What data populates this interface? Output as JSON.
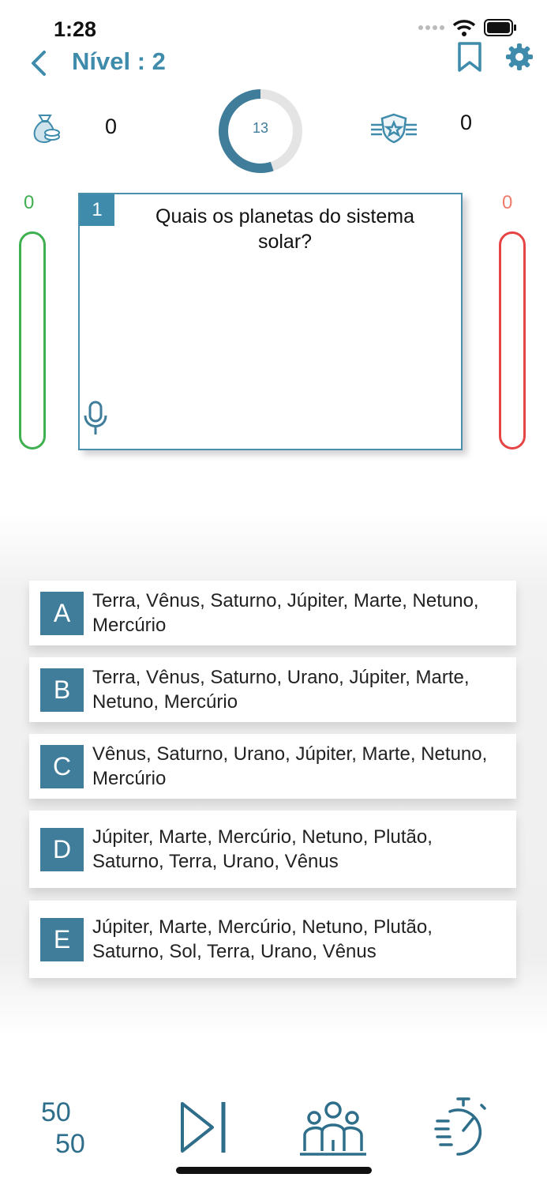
{
  "status_bar": {
    "time": "1:28"
  },
  "nav": {
    "title": "Nível : 2",
    "back_icon": "chevron-left-icon",
    "bookmark_icon": "bookmark-icon",
    "settings_icon": "gear-icon"
  },
  "stats": {
    "coins": "0",
    "timer": "13",
    "timer_progress": 0.55,
    "score": "0"
  },
  "bars": {
    "correct": "0",
    "wrong": "0"
  },
  "question": {
    "number": "1",
    "text": "Quais os planetas do sistema solar?"
  },
  "answers": [
    {
      "letter": "A",
      "text": "Terra, Vênus, Saturno, Júpiter, Marte, Netuno, Mercúrio"
    },
    {
      "letter": "B",
      "text": "Terra, Vênus, Saturno, Urano, Júpiter, Marte, Netuno, Mercúrio"
    },
    {
      "letter": "C",
      "text": "Vênus, Saturno, Urano, Júpiter, Marte, Netuno, Mercúrio"
    },
    {
      "letter": "D",
      "text": "Júpiter, Marte, Mercúrio, Netuno, Plutão, Saturno, Terra, Urano, Vênus"
    },
    {
      "letter": "E",
      "text": "Júpiter, Marte, Mercúrio, Netuno, Plutão, Saturno, Sol, Terra, Urano, Vênus"
    }
  ],
  "toolbar": {
    "fifty_top": "50",
    "fifty_bottom": "50",
    "items": [
      "fifty-fifty-icon",
      "skip-icon",
      "audience-icon",
      "stopwatch-icon"
    ]
  },
  "colors": {
    "accent": "#3f8bac",
    "correct": "#3fb04f",
    "wrong": "#e64545"
  }
}
